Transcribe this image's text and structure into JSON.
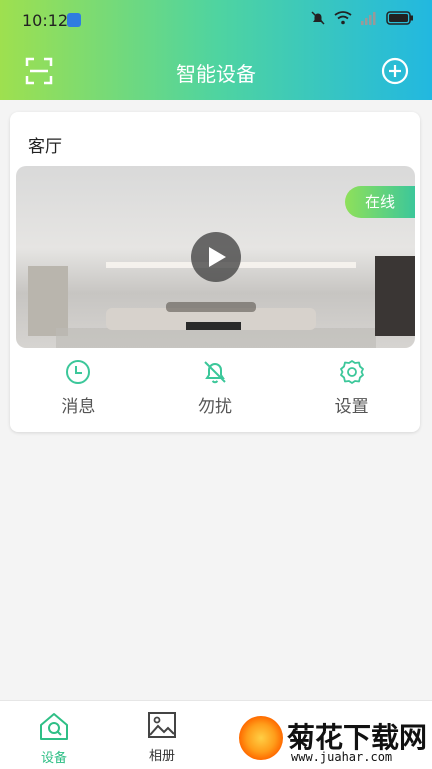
{
  "status_bar": {
    "time": "10:12"
  },
  "header": {
    "title": "智能设备",
    "gradient": [
      "#9ee04f",
      "#4fd4a0",
      "#22b8e0"
    ]
  },
  "device_card": {
    "room_name": "客厅",
    "status_badge": "在线",
    "actions": [
      {
        "label": "消息",
        "icon": "clock-icon"
      },
      {
        "label": "勿扰",
        "icon": "bell-off-icon"
      },
      {
        "label": "设置",
        "icon": "gear-icon"
      }
    ]
  },
  "bottom_nav": {
    "items": [
      {
        "label": "设备",
        "icon": "home-camera-icon",
        "active": true
      },
      {
        "label": "相册",
        "icon": "image-icon",
        "active": false
      }
    ]
  },
  "watermark": {
    "brand": "菊花下载网",
    "url": "www.juahar.com"
  },
  "colors": {
    "accent": "#2fbf86",
    "action_icon": "#3cc79a"
  }
}
